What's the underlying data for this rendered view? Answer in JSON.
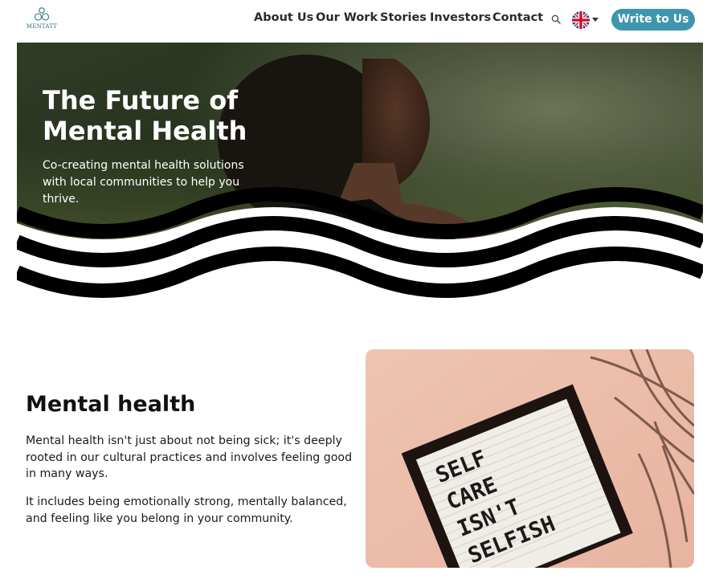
{
  "brand": {
    "name": "MENTATT",
    "accent": "#3e96ad"
  },
  "nav": {
    "items": [
      {
        "key": "about",
        "label": "About Us"
      },
      {
        "key": "work",
        "label": "Our Work"
      },
      {
        "key": "stories",
        "label": "Stories"
      },
      {
        "key": "investors",
        "label": "Investors"
      },
      {
        "key": "contact",
        "label": "Contact"
      }
    ],
    "search_icon": "search-icon",
    "language_icon": "uk-flag-icon",
    "cta_label": "Write to Us"
  },
  "hero": {
    "title": "The Future of Mental Health",
    "subtitle": "Co-creating mental health solutions with local communities to help you thrive."
  },
  "section": {
    "title": "Mental health",
    "paragraphs": [
      "Mental health isn't just about not being sick; it's deeply rooted in our cultural practices and involves feeling good in many ways.",
      "It includes being emotionally strong, mentally balanced, and feeling like you belong in your community."
    ],
    "image_sign_lines": [
      "SELF",
      "CARE",
      "ISN'T",
      "SELFISH"
    ]
  }
}
